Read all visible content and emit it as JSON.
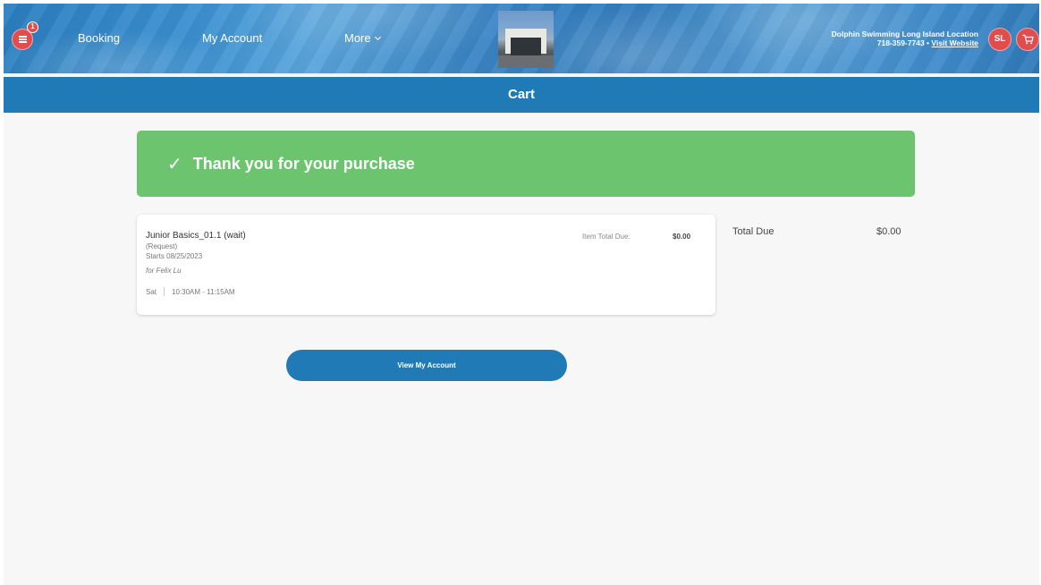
{
  "header": {
    "notification_count": "1",
    "nav": {
      "booking": "Booking",
      "my_account": "My Account",
      "more": "More"
    },
    "location": {
      "name": "Dolphin Swimming Long Island Location",
      "phone": "718-359-7743",
      "separator": "•",
      "website_link": "Visit Website"
    },
    "user_initials": "SL"
  },
  "page_title": "Cart",
  "success_banner": {
    "icon": "checkmark-icon",
    "message": "Thank you for your purchase"
  },
  "cart_item": {
    "title": "Junior Basics_01.1 (wait)",
    "status": "(Request)",
    "starts": "Starts 08/25/2023",
    "for": "for Felix Lu",
    "day": "Sat",
    "time": "10:30AM - 11:15AM",
    "item_total_label": "Item Total Due:",
    "item_total_value": "$0.00"
  },
  "totals": {
    "label": "Total Due",
    "value": "$0.00"
  },
  "view_account_button": "View My Account",
  "colors": {
    "primary_blue": "#1f7ab6",
    "success_green": "#6cc46e",
    "accent_red": "#e14d4d"
  }
}
